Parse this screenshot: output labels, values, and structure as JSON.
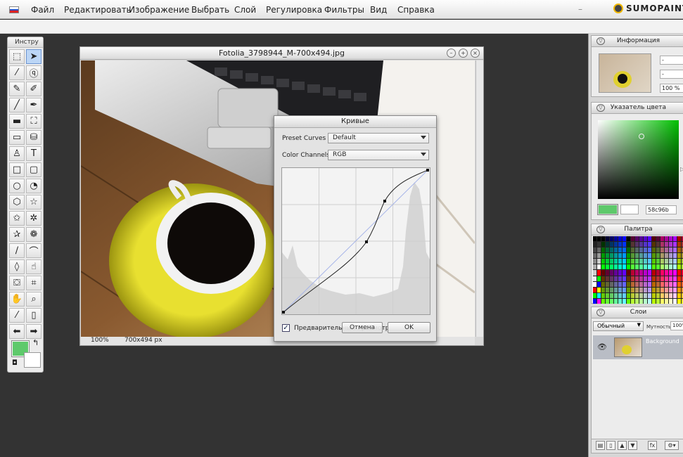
{
  "menubar": {
    "items": [
      "Файл",
      "Редактировать",
      "Изображение",
      "Выбрать",
      "Слой",
      "Регулировка",
      "Фильтры",
      "Вид",
      "Справка"
    ],
    "minimize": "–",
    "logo_text": "SUMOPAINT.C"
  },
  "toolbox": {
    "title": "Инстру",
    "tools": [
      "marquee-rect",
      "move",
      "magic-wand",
      "lasso",
      "brush",
      "smudge",
      "pencil",
      "paintbrush",
      "eraser",
      "eyedropper-fill",
      "gradient",
      "paint-bucket",
      "stamp",
      "text",
      "rect-shape",
      "rounded-rect-shape",
      "ellipse-shape",
      "arc-shape",
      "hexagon-shape",
      "star-shape",
      "star-outline-shape",
      "gear-star-shape",
      "badge-shape",
      "flower-shape",
      "line",
      "curve",
      "drop",
      "smudge-finger",
      "crop",
      "transform",
      "hand",
      "zoom",
      "picker",
      "bucket-fill",
      "arrow-left",
      "arrow-right"
    ],
    "fg_color": "#5ec96b",
    "bg_color": "#ffffff"
  },
  "image_window": {
    "title": "Fotolia_3798944_M-700x494.jpg",
    "zoom": "100%",
    "size": "700x494 px"
  },
  "curves_dialog": {
    "title": "Кривые",
    "preset_label": "Preset Curves",
    "preset_value": "Default",
    "channels_label": "Color Channels",
    "channels_value": "RGB",
    "preview_label": "Предварительный просмотр",
    "cancel_label": "Отмена",
    "ok_label": "OK"
  },
  "panels": {
    "info": {
      "title": "Информация",
      "field1": "-",
      "field2": "-",
      "zoom": "100 %"
    },
    "color": {
      "title": "Указатель цвета",
      "hex": "58c96b",
      "current_color": "#5ec96b"
    },
    "palette": {
      "title": "Палитра"
    },
    "layers": {
      "title": "Слои",
      "blend_mode": "Обычный",
      "opacity_label": "Мутность:",
      "opacity_value": "100%",
      "layer_name": "Background"
    }
  }
}
